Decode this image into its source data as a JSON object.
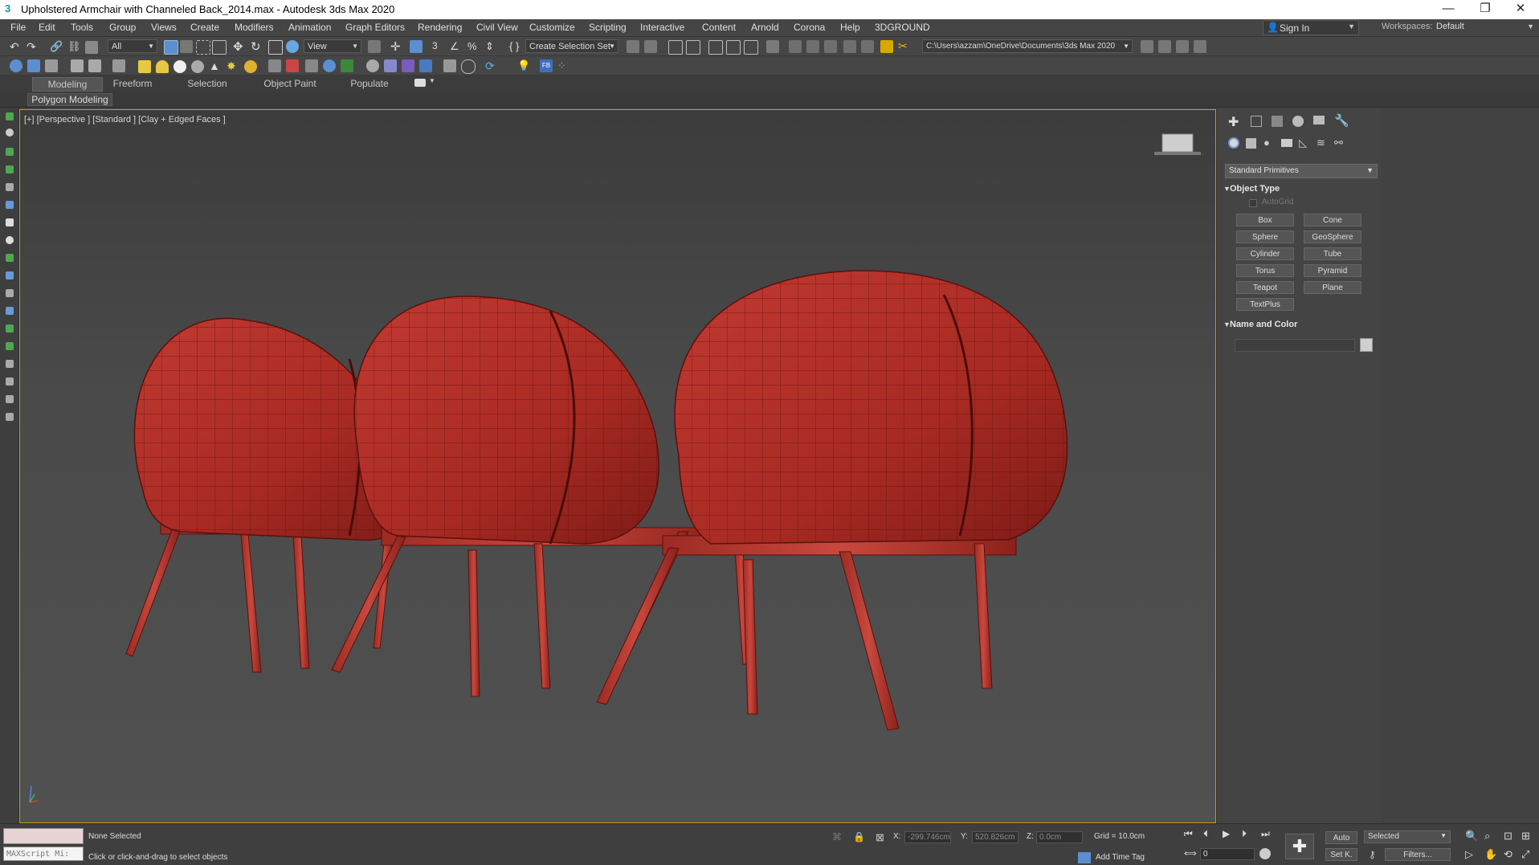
{
  "title": "Upholstered Armchair with Channeled Back_2014.max - Autodesk 3ds Max 2020",
  "window_buttons": [
    "—",
    "❐",
    "✕"
  ],
  "menu": [
    "File",
    "Edit",
    "Tools",
    "Group",
    "Views",
    "Create",
    "Modifiers",
    "Animation",
    "Graph Editors",
    "Rendering",
    "Civil View",
    "Customize",
    "Scripting",
    "Interactive",
    "Content",
    "Arnold",
    "Corona",
    "Help",
    "3DGROUND"
  ],
  "account": {
    "sign_in": "Sign In",
    "workspaces_label": "Workspaces:",
    "workspace": "Default"
  },
  "toolbar": {
    "selection_filter": "All",
    "ref_coord": "View",
    "selection_set": "Create Selection Set",
    "project_path": "C:\\Users\\azzam\\OneDrive\\Documents\\3ds Max 2020"
  },
  "ribbon": {
    "tabs": [
      "Modeling",
      "Freeform",
      "Selection",
      "Object Paint",
      "Populate"
    ],
    "subtab": "Polygon Modeling"
  },
  "viewport": {
    "label": "[+] [Perspective ] [Standard ] [Clay + Edged Faces ]"
  },
  "command_panel": {
    "category": "Standard Primitives",
    "object_type_title": "Object Type",
    "autogrid": "AutoGrid",
    "buttons": [
      "Box",
      "Cone",
      "Sphere",
      "GeoSphere",
      "Cylinder",
      "Tube",
      "Torus",
      "Pyramid",
      "Teapot",
      "Plane",
      "TextPlus"
    ],
    "name_color_title": "Name and Color"
  },
  "status": {
    "maxscript": "MAXScript Mi:",
    "selection": "None Selected",
    "prompt": "Click or click-and-drag to select objects",
    "x_label": "X:",
    "x_value": "-299.746cm",
    "y_label": "Y:",
    "y_value": "520.826cm",
    "z_label": "Z:",
    "z_value": "0.0cm",
    "grid": "Grid = 10.0cm",
    "add_time_tag": "Add Time Tag",
    "auto": "Auto",
    "set_key": "Set K.",
    "key_filter": "Selected",
    "filters": "Filters...",
    "frame": "0"
  },
  "colors": {
    "accent_viewport_border": "#c8a000",
    "chair_red": "#b8322a",
    "chair_dark": "#7a1b16"
  }
}
